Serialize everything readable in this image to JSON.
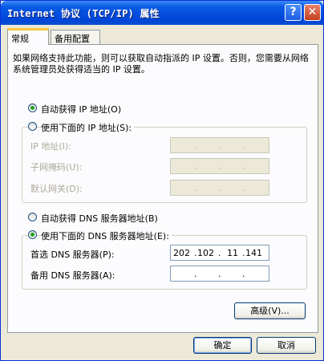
{
  "window": {
    "title": "Internet 协议 (TCP/IP) 属性",
    "help_glyph": "?",
    "close_glyph": "✕"
  },
  "tabs": [
    {
      "label": "常规",
      "active": true
    },
    {
      "label": "备用配置",
      "active": false
    }
  ],
  "description": "如果网络支持此功能，则可以获取自动指派的 IP 设置。否则，您需要从网络系统管理员处获得适当的 IP 设置。",
  "ip_section": {
    "auto_option": "自动获得 IP 地址(O)",
    "manual_option": "使用下面的 IP 地址(S):",
    "auto_selected": true,
    "fields": [
      {
        "label": "IP 地址(I):",
        "value": [
          "",
          "",
          "",
          ""
        ]
      },
      {
        "label": "子网掩码(U):",
        "value": [
          "",
          "",
          "",
          ""
        ]
      },
      {
        "label": "默认网关(D):",
        "value": [
          "",
          "",
          "",
          ""
        ]
      }
    ]
  },
  "dns_section": {
    "auto_option": "自动获得 DNS 服务器地址(B)",
    "manual_option": "使用下面的 DNS 服务器地址(E):",
    "manual_selected": true,
    "preferred": {
      "label": "首选 DNS 服务器(P):",
      "value": [
        "202",
        "102",
        "11",
        "141"
      ]
    },
    "alternate": {
      "label": "备用 DNS 服务器(A):",
      "value": [
        "",
        "",
        "",
        ""
      ]
    }
  },
  "buttons": {
    "advanced": "高级(V)...",
    "ok": "确定",
    "cancel": "取消"
  },
  "ip_separator": "."
}
